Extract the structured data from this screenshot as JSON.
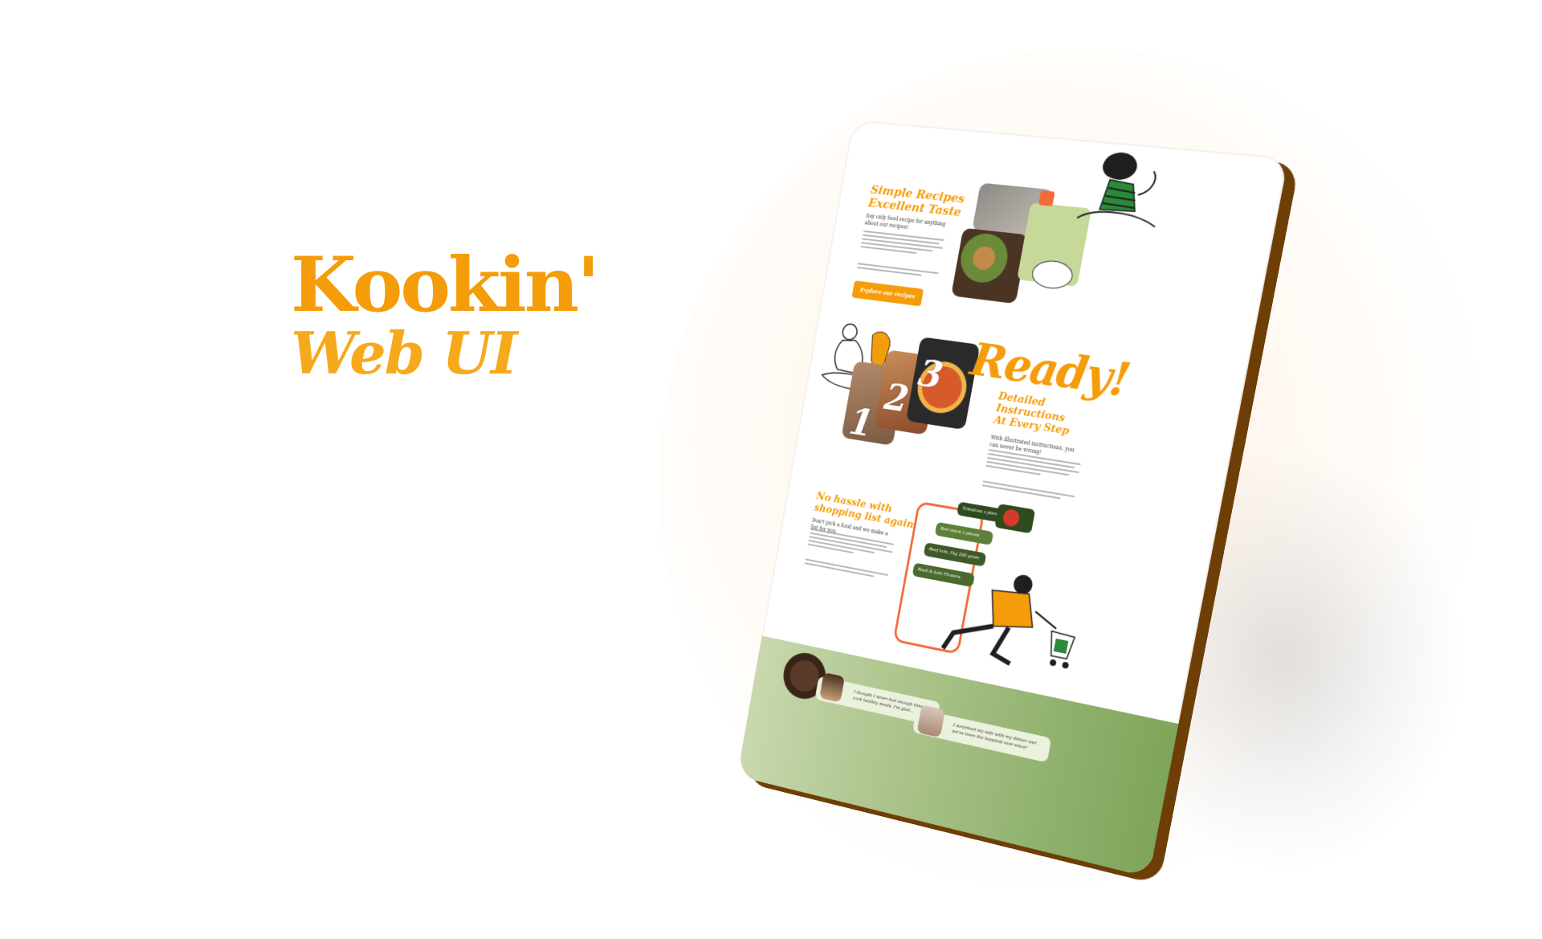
{
  "brand": {
    "line1": "Kookin'",
    "line2": "Web UI",
    "color": "#f59c0a"
  },
  "tablet": {
    "hero": {
      "heading_line1": "Simple Recipes",
      "heading_line2": "Excellent Taste",
      "intro": "Say only food recipe for anything about our recipes!",
      "button_label": "Explore our recipes"
    },
    "instructions": {
      "title": "Ready!",
      "steps": [
        "1",
        "2",
        "3"
      ],
      "heading_line1": "Detailed",
      "heading_line2": "Instructions",
      "heading_line3": "At Every Step",
      "intro": "With illustrated instructions, you can never be wrong!"
    },
    "shopping": {
      "heading_line1": "No hassle with",
      "heading_line2": "shopping list again",
      "intro": "Don't pick a food and we make a list for you.",
      "list_items": [
        "Tomatoes x pieces",
        "Red onion x pieces",
        "Beef loin, 1kg 200 gram",
        "Basil & kale Flowers"
      ]
    },
    "testimonials": [
      {
        "quote": "I thought I never had enough time to cook healthy meals. I'm glad..."
      },
      {
        "quote": "I surprised my wife with my dinner and we've been the happiest ever since!"
      }
    ]
  },
  "colors": {
    "accent": "#f59c0a",
    "tablet_edge": "#6e3e07",
    "green_dark": "#2f4a1e",
    "green_mid": "#5e7f3a",
    "phone_outline": "#f26b3a"
  }
}
